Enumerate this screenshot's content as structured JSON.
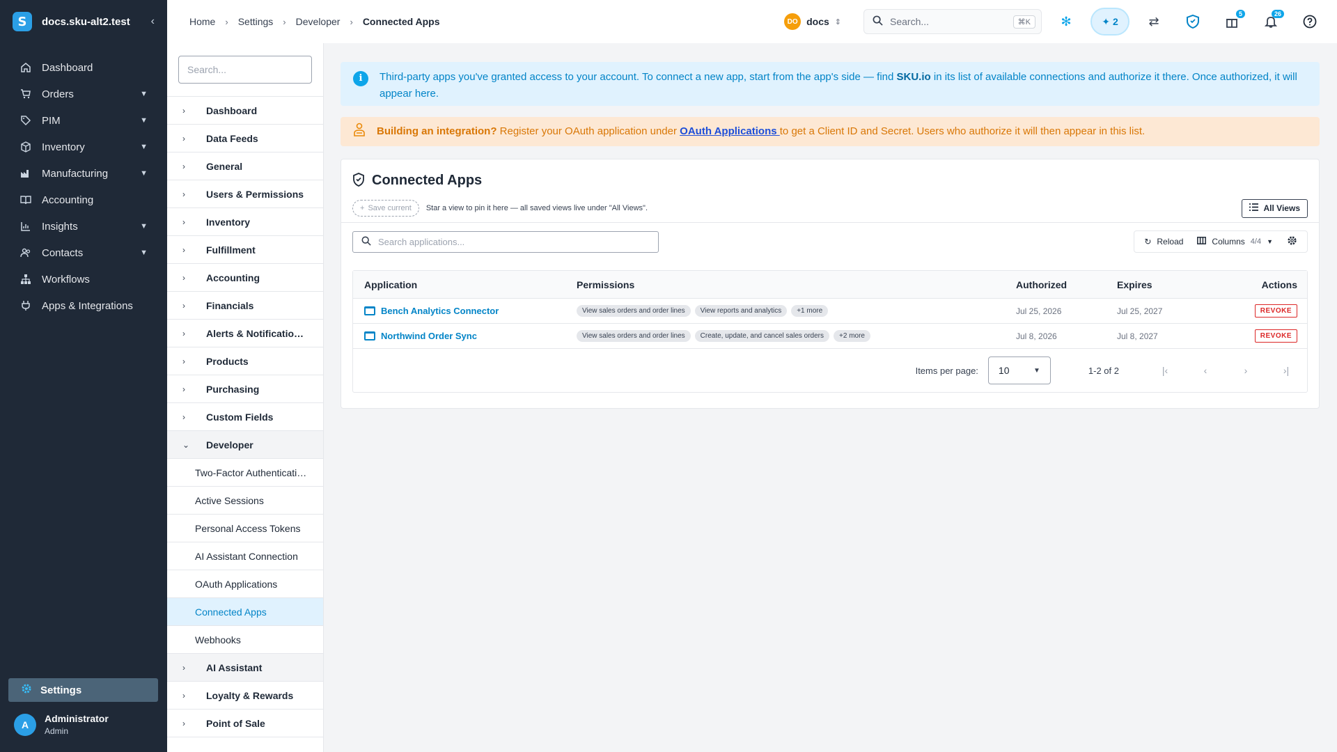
{
  "app": {
    "org_name": "docs.sku-alt2.test",
    "logo_letter": "S",
    "collapse_glyph": "‹"
  },
  "sidebar": {
    "items": [
      {
        "label": "Dashboard",
        "icon": "home-icon",
        "has_children": false
      },
      {
        "label": "Orders",
        "icon": "cart-icon",
        "has_children": true
      },
      {
        "label": "PIM",
        "icon": "tag-icon",
        "has_children": true
      },
      {
        "label": "Inventory",
        "icon": "box-icon",
        "has_children": true
      },
      {
        "label": "Manufacturing",
        "icon": "factory-icon",
        "has_children": true
      },
      {
        "label": "Accounting",
        "icon": "book-icon",
        "has_children": false
      },
      {
        "label": "Insights",
        "icon": "chart-icon",
        "has_children": true
      },
      {
        "label": "Contacts",
        "icon": "people-icon",
        "has_children": true
      },
      {
        "label": "Workflows",
        "icon": "sitemap-icon",
        "has_children": false
      },
      {
        "label": "Apps & Integrations",
        "icon": "plug-icon",
        "has_children": false
      }
    ],
    "settings_label": "Settings",
    "user": {
      "initial": "A",
      "name": "Administrator",
      "role": "Admin"
    }
  },
  "topbar": {
    "breadcrumbs": [
      "Home",
      "Settings",
      "Developer",
      "Connected Apps"
    ],
    "workspace": {
      "initials": "DO",
      "name": "docs"
    },
    "search_placeholder": "Search...",
    "search_shortcut": "⌘K",
    "ai_count": "2",
    "gift_badge": "5",
    "notifications_badge": "26"
  },
  "settings_menu": {
    "search_placeholder": "Search...",
    "sections_top": [
      "Dashboard",
      "Data Feeds",
      "General",
      "Users & Permissions",
      "Inventory",
      "Fulfillment",
      "Accounting",
      "Financials",
      "Alerts & Notificatio…",
      "Products",
      "Purchasing",
      "Custom Fields"
    ],
    "open_section": "Developer",
    "sub_items": [
      "Two-Factor Authenticati…",
      "Active Sessions",
      "Personal Access Tokens",
      "AI Assistant Connection",
      "OAuth Applications",
      "Connected Apps",
      "Webhooks"
    ],
    "active_sub": "Connected Apps",
    "sections_bottom": [
      "AI Assistant",
      "Loyalty & Rewards",
      "Point of Sale"
    ]
  },
  "info_alert": {
    "text_before": "Third-party apps you've granted access to your account. To connect a new app, start from the app's side — find ",
    "brand": "SKU.io",
    "text_after": " in its list of available connections and authorize it there. Once authorized, it will appear here."
  },
  "warn_alert": {
    "lead": "Building an integration?",
    "text_before": " Register your OAuth application under ",
    "link": "OAuth Applications ",
    "text_after": "to get a Client ID and Secret. Users who authorize it will then appear in this list."
  },
  "card": {
    "title": "Connected Apps",
    "save_current": "Save current",
    "views_hint": "Star a view to pin it here — all saved views live under \"All Views\".",
    "all_views": "All Views",
    "search_placeholder": "Search applications...",
    "reload": "Reload",
    "columns": "Columns",
    "columns_count": "4/4"
  },
  "table": {
    "headers": {
      "application": "Application",
      "permissions": "Permissions",
      "authorized": "Authorized",
      "expires": "Expires",
      "actions": "Actions"
    },
    "rows": [
      {
        "name": "Bench Analytics Connector",
        "perms": [
          "View sales orders and order lines",
          "View reports and analytics",
          "+1 more"
        ],
        "authorized": "Jul 25, 2026",
        "expires": "Jul 25, 2027",
        "action": "REVOKE"
      },
      {
        "name": "Northwind Order Sync",
        "perms": [
          "View sales orders and order lines",
          "Create, update, and cancel sales orders",
          "+2 more"
        ],
        "authorized": "Jul 8, 2026",
        "expires": "Jul 8, 2027",
        "action": "REVOKE"
      }
    ]
  },
  "pager": {
    "label": "Items per page:",
    "per_page": "10",
    "range": "1-2 of 2"
  }
}
